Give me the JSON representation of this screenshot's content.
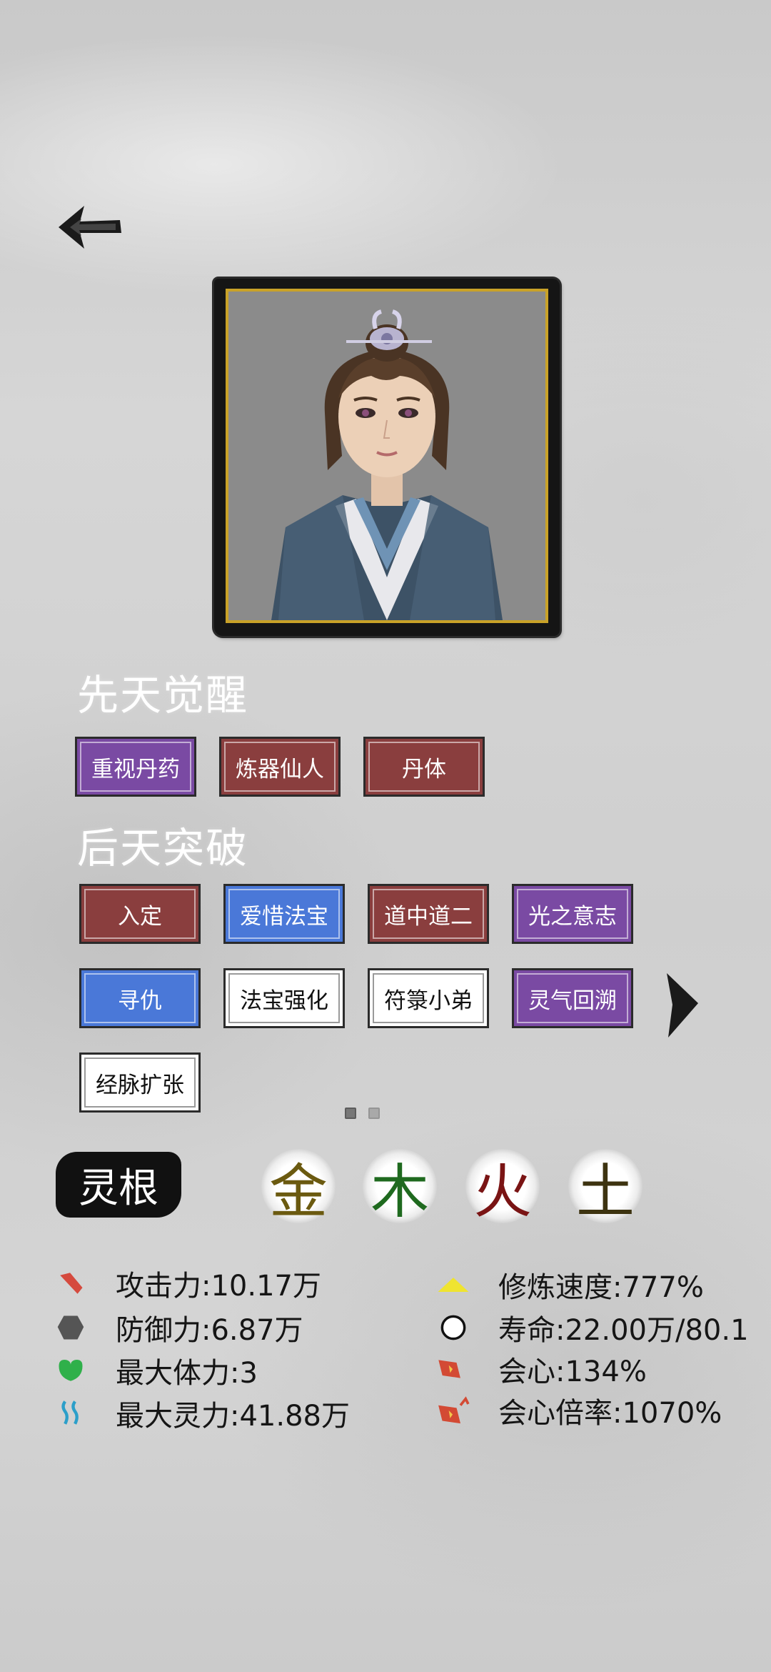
{
  "innate": {
    "title": "先天觉醒",
    "traits": [
      {
        "label": "重视丹药",
        "color": "purple"
      },
      {
        "label": "炼器仙人",
        "color": "red"
      },
      {
        "label": "丹体",
        "color": "red"
      }
    ]
  },
  "acquired": {
    "title": "后天突破",
    "traits": [
      {
        "label": "入定",
        "color": "red"
      },
      {
        "label": "爱惜法宝",
        "color": "blue"
      },
      {
        "label": "道中道二",
        "color": "red"
      },
      {
        "label": "光之意志",
        "color": "purple"
      },
      {
        "label": "寻仇",
        "color": "blue"
      },
      {
        "label": "法宝强化",
        "color": "white"
      },
      {
        "label": "符箓小弟",
        "color": "white"
      },
      {
        "label": "灵气回溯",
        "color": "purple"
      },
      {
        "label": "经脉扩张",
        "color": "white"
      }
    ]
  },
  "pagination": {
    "current": 1,
    "total": 2
  },
  "spirit_root": {
    "label": "灵根",
    "elements": [
      {
        "char": "金",
        "color": "#6b5a10"
      },
      {
        "char": "木",
        "color": "#1f6a1f"
      },
      {
        "char": "火",
        "color": "#7a1414"
      },
      {
        "char": "土",
        "color": "#3d3310"
      }
    ]
  },
  "stats": {
    "attack": "攻击力:10.17万",
    "defense": "防御力:6.87万",
    "max_hp": "最大体力:3",
    "max_spirit": "最大灵力:41.88万",
    "cultivation_speed": "修炼速度:777%",
    "lifespan": "寿命:22.00万/80.1",
    "crit": "会心:134%",
    "crit_multiplier": "会心倍率:1070%"
  },
  "icons": {
    "back": "back-arrow-icon",
    "next": "next-page-arrow-icon",
    "attack": "sword-icon",
    "defense": "shield-icon",
    "max_hp": "heart-icon",
    "max_spirit": "spirit-wave-icon",
    "cultivation_speed": "triangle-icon",
    "lifespan": "circle-icon",
    "crit": "crit-icon",
    "crit_multiplier": "crit-multiplier-icon"
  },
  "colors": {
    "purple": "#7a4aa3",
    "red": "#8a3e3e",
    "blue": "#4a78d8",
    "white": "#ffffff",
    "frame_gold": "#c9a228"
  }
}
